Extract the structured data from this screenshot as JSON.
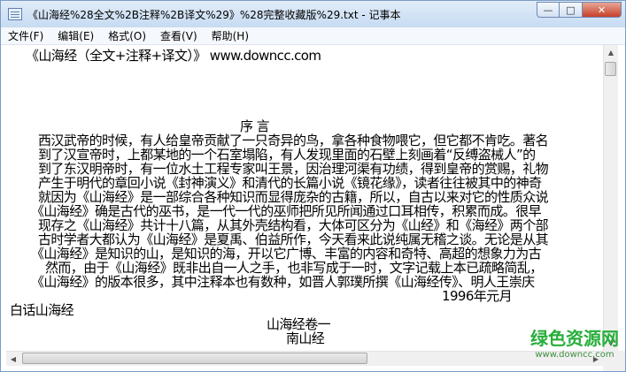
{
  "window": {
    "title": "《山海经%28全文%2B注释%2B译文%29》%28完整收藏版%29.txt - 记事本",
    "minimize": "—",
    "maximize": "□",
    "close": "✕"
  },
  "menu": [
    {
      "label": "文件(F)"
    },
    {
      "label": "编辑(E)"
    },
    {
      "label": "格式(O)"
    },
    {
      "label": "查看(V)"
    },
    {
      "label": "帮助(H)"
    }
  ],
  "document": {
    "lines": [
      "《山海经（全文+注释+译文）》 www.downcc.com",
      "序 言",
      "西汉武帝的时候，有人给皇帝贡献了一只奇异的鸟，拿各种食物喂它，但它都不肯吃。著名",
      "到了汉宣帝时，上都某地的一个石室塌陷，有人发现里面的石壁上刻画着“反缚盗械人”的",
      "到了东汉明帝时，有一位水土工程专家叫王景，因治理河渠有功绩，得到皇帝的赏赐，礼物",
      "产生于明代的章回小说《封神演义》和清代的长篇小说《镜花缘》，读者往往被其中的神奇",
      "就因为《山海经》是一部综合各种知识而显得庞杂的古籍，所以，自古以来对它的性质众说",
      "《山海经》确是古代的巫书，是一代一代的巫师把所见所闻通过口耳相传，积累而成。很早",
      "现存之《山海经》共计十八篇，从其外壳结构看，大体可区分为《山经》和《海经》两个部",
      "古时学者大都认为《山海经》是夏禹、伯益所作，今天看来此说纯属无稽之谈。无论是从其",
      "《山海经》是知识的山，是知识的海，开以它广博、丰富的内容和奇特、高超的想象力为古",
      "然而，由于《山海经》既非出自一人之手，也非写成于一时，文字记载上本已疏略简乱，",
      "《山海经》的版本很多，其中注释本也有数种，如晋人郭璞所撰《山海经传》、明人王崇庆",
      "1996年元月",
      "白话山海经",
      "山海经卷一",
      "南山经"
    ]
  },
  "watermark": {
    "text": "绿色资源网",
    "url": "www.downcc.com"
  }
}
